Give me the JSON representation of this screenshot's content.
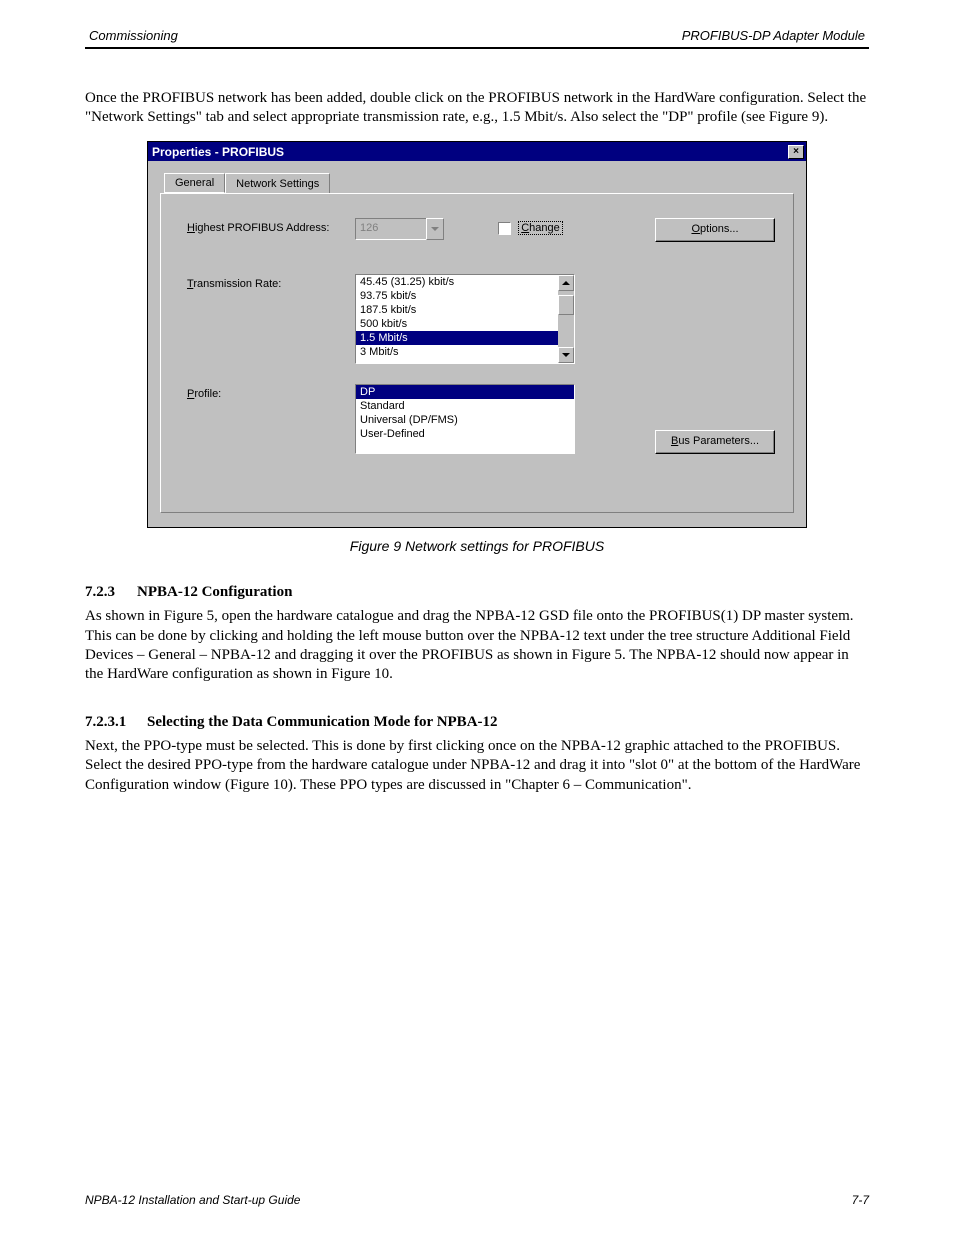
{
  "header": {
    "left": "Commissioning",
    "right": "PROFIBUS-DP Adapter Module"
  },
  "intro": [
    "Once the PROFIBUS network has been added, double click on the PROFIBUS network in the HardWare configuration. Select the \"Network Settings\" tab and select appropriate transmission rate, e.g., 1.5 Mbit/s. Also select the \"DP\" profile (see Figure 9)."
  ],
  "figure_caption": "Figure 9   Network settings for PROFIBUS",
  "section1": {
    "num": "7.2.3",
    "title": "NPBA-12 Configuration"
  },
  "section1_body": [
    "As shown in Figure 5, open the hardware catalogue and drag the NPBA-12 GSD file onto the PROFIBUS(1) DP master system. This can be done by clicking and holding the left mouse button over the NPBA-12 text under the tree structure Additional Field Devices – General – NPBA-12 and dragging it over the PROFIBUS as shown in Figure 5. The NPBA-12 should now appear in the HardWare configuration as shown in Figure 10."
  ],
  "section2": {
    "num": "7.2.3.1",
    "title": "Selecting the Data Communication Mode for NPBA-12"
  },
  "section2_body": [
    "Next, the PPO-type must be selected. This is done by first clicking once on the NPBA-12 graphic attached to the PROFIBUS. Select the desired PPO-type from the hardware catalogue under NPBA-12 and drag it into \"slot 0\" at the bottom of the HardWare Configuration window (Figure 10). These PPO types are discussed in \"Chapter 6 – Communication\"."
  ],
  "dialog": {
    "title": "Properties - PROFIBUS",
    "tabs": [
      "General",
      "Network Settings"
    ],
    "active_tab": 1,
    "addr_label_pre": "H",
    "addr_label_rest": "ighest PROFIBUS Address:",
    "addr_value": "126",
    "change_pre": "C",
    "change_rest": "hange",
    "rate_label_pre": "T",
    "rate_label_rest": "ransmission Rate:",
    "rate_items": [
      "45.45 (31.25) kbit/s",
      "93.75 kbit/s",
      "187.5 kbit/s",
      "500 kbit/s",
      "1.5 Mbit/s",
      "3 Mbit/s"
    ],
    "rate_selected_index": 4,
    "profile_label_pre": "P",
    "profile_label_rest": "rofile:",
    "profile_items": [
      "DP",
      "Standard",
      "Universal (DP/FMS)",
      "User-Defined"
    ],
    "profile_selected_index": 0,
    "options_pre": "O",
    "options_rest": "ptions...",
    "busparams_pre": "B",
    "busparams_rest": "us Parameters..."
  },
  "footer": {
    "left": "NPBA-12 Installation and Start-up Guide",
    "right": "7-7"
  }
}
